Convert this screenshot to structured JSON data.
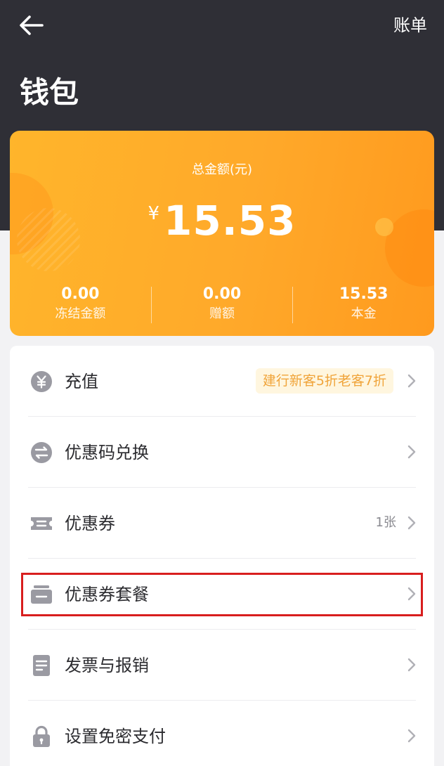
{
  "header": {
    "back_icon": "arrow-left-icon",
    "bill_label": "账单",
    "title": "钱包"
  },
  "wallet": {
    "total_label": "总金额(元)",
    "currency_symbol": "¥",
    "total_amount": "15.53",
    "stats": [
      {
        "value": "0.00",
        "label": "冻结金额"
      },
      {
        "value": "0.00",
        "label": "赠额"
      },
      {
        "value": "15.53",
        "label": "本金"
      }
    ]
  },
  "menu": {
    "items": [
      {
        "label": "充值",
        "icon": "yuan-coin-icon",
        "badge": "建行新客5折老客7折"
      },
      {
        "label": "优惠码兑换",
        "icon": "exchange-icon"
      },
      {
        "label": "优惠券",
        "icon": "coupon-icon",
        "count": "1张"
      },
      {
        "label": "优惠券套餐",
        "icon": "coupon-package-icon"
      },
      {
        "label": "发票与报销",
        "icon": "invoice-icon"
      },
      {
        "label": "设置免密支付",
        "icon": "lock-icon"
      }
    ]
  },
  "colors": {
    "header_bg": "#2f2f36",
    "card_orange": "#ffa92a",
    "badge_text": "#f0a43a",
    "badge_bg": "#fff6df",
    "highlight_red": "#d81e1e"
  }
}
